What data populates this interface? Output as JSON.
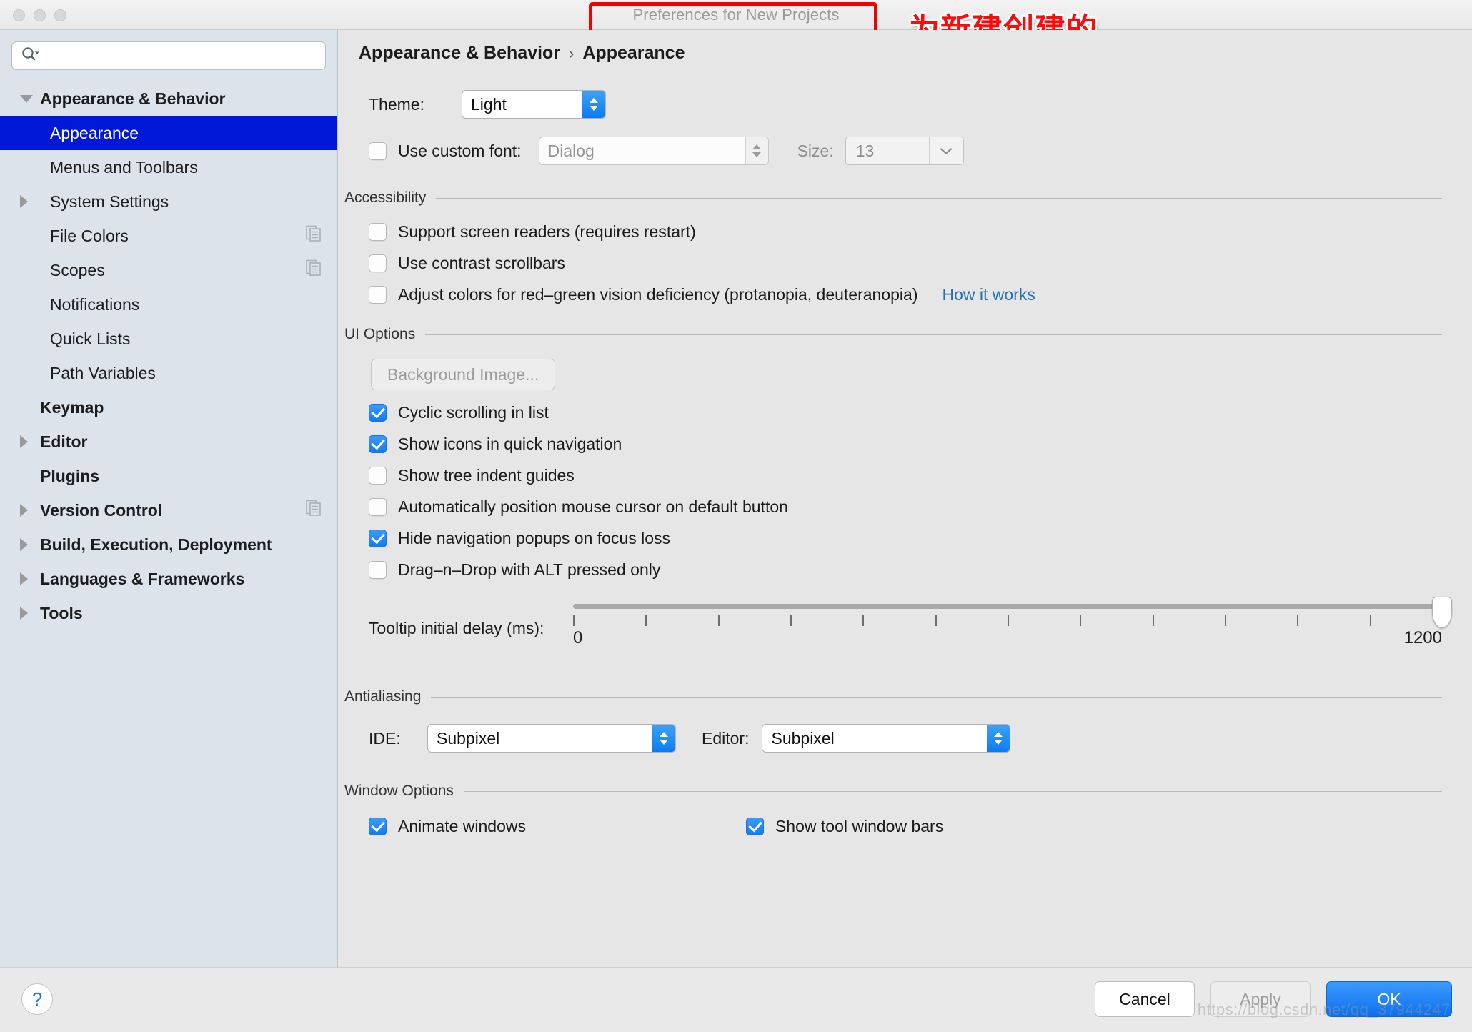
{
  "window": {
    "title": "Preferences for New Projects",
    "traffic_lights": [
      "close",
      "minimize",
      "zoom"
    ]
  },
  "annotation": {
    "chinese_note": "为新建创建的\n项目设置配置",
    "color": "#fb0b0b",
    "highlight_box_color": "#f40000"
  },
  "search": {
    "placeholder": "",
    "value": "",
    "icon": "search-icon"
  },
  "sidebar": {
    "items": [
      {
        "label": "Appearance & Behavior",
        "level": 0,
        "bold": true,
        "twisty": "down",
        "selected": false,
        "copy_icon": false
      },
      {
        "label": "Appearance",
        "level": 1,
        "bold": false,
        "twisty": "none",
        "selected": true,
        "copy_icon": false
      },
      {
        "label": "Menus and Toolbars",
        "level": 1,
        "bold": false,
        "twisty": "none",
        "selected": false,
        "copy_icon": false
      },
      {
        "label": "System Settings",
        "level": 1,
        "bold": false,
        "twisty": "right",
        "selected": false,
        "copy_icon": false
      },
      {
        "label": "File Colors",
        "level": 1,
        "bold": false,
        "twisty": "none",
        "selected": false,
        "copy_icon": true
      },
      {
        "label": "Scopes",
        "level": 1,
        "bold": false,
        "twisty": "none",
        "selected": false,
        "copy_icon": true
      },
      {
        "label": "Notifications",
        "level": 1,
        "bold": false,
        "twisty": "none",
        "selected": false,
        "copy_icon": false
      },
      {
        "label": "Quick Lists",
        "level": 1,
        "bold": false,
        "twisty": "none",
        "selected": false,
        "copy_icon": false
      },
      {
        "label": "Path Variables",
        "level": 1,
        "bold": false,
        "twisty": "none",
        "selected": false,
        "copy_icon": false
      },
      {
        "label": "Keymap",
        "level": 0,
        "bold": true,
        "twisty": "none",
        "selected": false,
        "copy_icon": false
      },
      {
        "label": "Editor",
        "level": 0,
        "bold": true,
        "twisty": "right",
        "selected": false,
        "copy_icon": false
      },
      {
        "label": "Plugins",
        "level": 0,
        "bold": true,
        "twisty": "none",
        "selected": false,
        "copy_icon": false
      },
      {
        "label": "Version Control",
        "level": 0,
        "bold": true,
        "twisty": "right",
        "selected": false,
        "copy_icon": true
      },
      {
        "label": "Build, Execution, Deployment",
        "level": 0,
        "bold": true,
        "twisty": "right",
        "selected": false,
        "copy_icon": false
      },
      {
        "label": "Languages & Frameworks",
        "level": 0,
        "bold": true,
        "twisty": "right",
        "selected": false,
        "copy_icon": false
      },
      {
        "label": "Tools",
        "level": 0,
        "bold": true,
        "twisty": "right",
        "selected": false,
        "copy_icon": false
      }
    ],
    "selected_accent": "#0019d8"
  },
  "breadcrumb": {
    "parent": "Appearance & Behavior",
    "separator": "›",
    "current": "Appearance"
  },
  "theme": {
    "label": "Theme:",
    "value": "Light"
  },
  "custom_font": {
    "checkbox_label": "Use custom font:",
    "checked": false,
    "font_value": "Dialog",
    "size_label": "Size:",
    "size_value": "13",
    "enabled": false
  },
  "accessibility": {
    "title": "Accessibility",
    "options": [
      {
        "label": "Support screen readers (requires restart)",
        "checked": false
      },
      {
        "label": "Use contrast scrollbars",
        "checked": false
      },
      {
        "label": "Adjust colors for red–green vision deficiency (protanopia, deuteranopia)",
        "checked": false
      }
    ],
    "link": "How it works",
    "link_color": "#2470b3"
  },
  "ui_options": {
    "title": "UI Options",
    "background_image_button": "Background Image...",
    "background_image_enabled": false,
    "options": [
      {
        "label": "Cyclic scrolling in list",
        "checked": true
      },
      {
        "label": "Show icons in quick navigation",
        "checked": true
      },
      {
        "label": "Show tree indent guides",
        "checked": false
      },
      {
        "label": "Automatically position mouse cursor on default button",
        "checked": false
      },
      {
        "label": "Hide navigation popups on focus loss",
        "checked": true
      },
      {
        "label": "Drag–n–Drop with ALT pressed only",
        "checked": false
      }
    ],
    "slider": {
      "label": "Tooltip initial delay (ms):",
      "min": 0,
      "max": 1200,
      "min_label": "0",
      "max_label": "1200",
      "value": 1200,
      "tick_count": 13
    }
  },
  "antialiasing": {
    "title": "Antialiasing",
    "ide_label": "IDE:",
    "ide_value": "Subpixel",
    "editor_label": "Editor:",
    "editor_value": "Subpixel"
  },
  "window_options": {
    "title": "Window Options",
    "options": [
      {
        "label": "Animate windows",
        "checked": true
      },
      {
        "label": "Show tool window bars",
        "checked": true
      }
    ]
  },
  "footer": {
    "help_label": "?",
    "cancel_label": "Cancel",
    "apply_label": "Apply",
    "apply_enabled": false,
    "ok_label": "OK",
    "ok_color": "#0c70ef"
  },
  "watermark": "https://blog.csdn.net/qq_37944247"
}
